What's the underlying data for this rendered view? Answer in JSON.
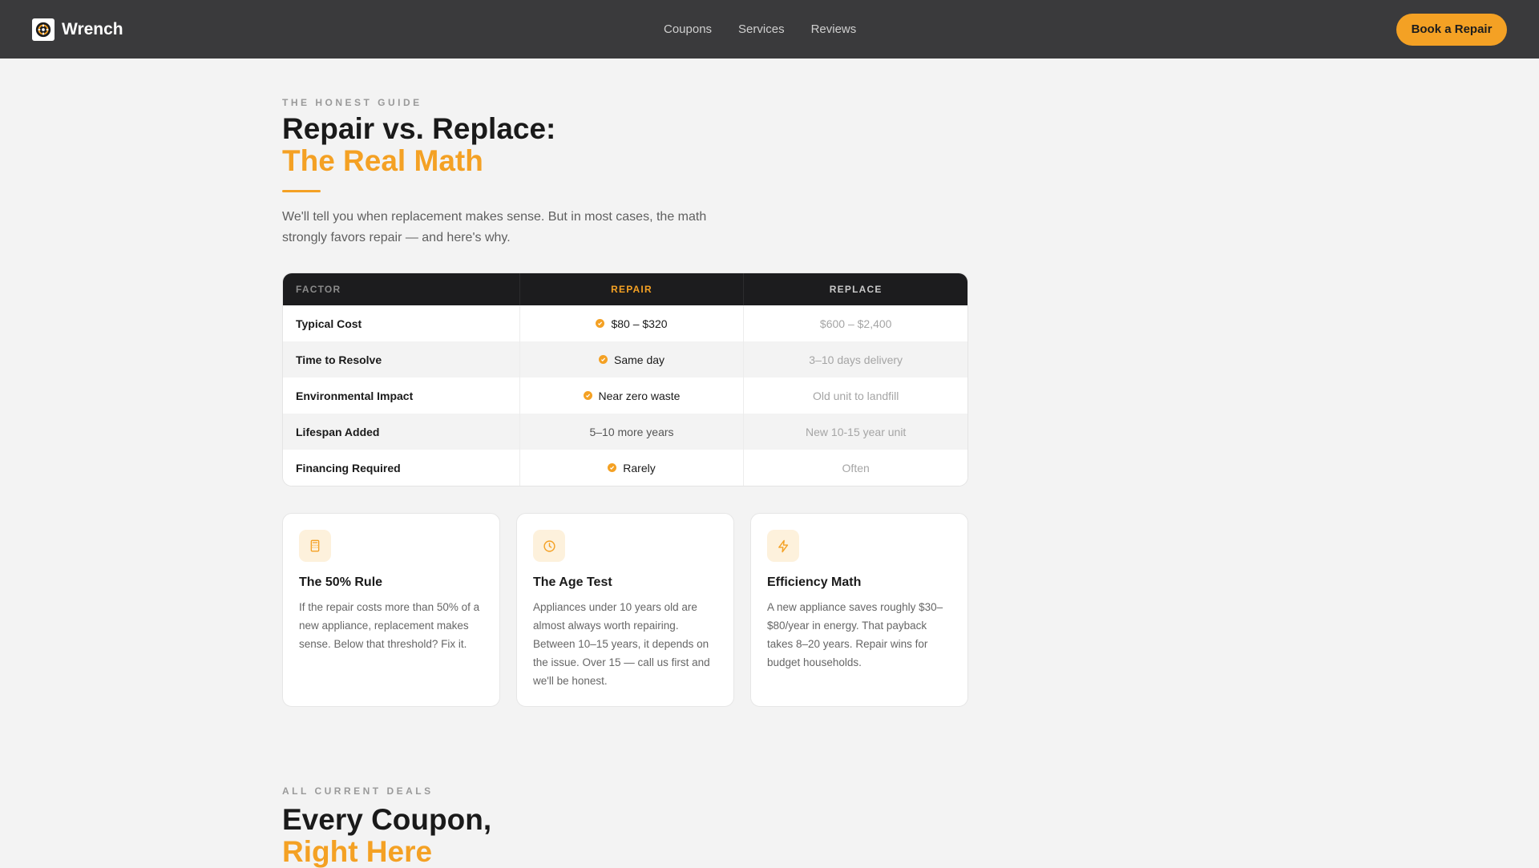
{
  "nav": {
    "brand": "Wrench",
    "links": [
      "Coupons",
      "Services",
      "Reviews"
    ],
    "cta": "Book a Repair"
  },
  "hero": {
    "eyebrow": "THE HONEST GUIDE",
    "title_line1": "Repair vs. Replace:",
    "title_line2": "The Real Math",
    "lede": "We'll tell you when replacement makes sense. But in most cases, the math strongly favors repair — and here's why."
  },
  "table": {
    "headers": [
      "FACTOR",
      "REPAIR",
      "REPLACE"
    ],
    "rows": [
      {
        "factor": "Typical Cost",
        "repair": "$80 – $320",
        "replace": "$600 – $2,400"
      },
      {
        "factor": "Time to Resolve",
        "repair": "Same day",
        "replace": "3–10 days delivery"
      },
      {
        "factor": "Environmental Impact",
        "repair": "Near zero waste",
        "replace": "Old unit to landfill"
      },
      {
        "factor": "Lifespan Added",
        "repair": "5–10 more years",
        "replace": "New 10-15 year unit"
      },
      {
        "factor": "Financing Required",
        "repair": "Rarely",
        "replace": "Often"
      }
    ]
  },
  "cards": [
    {
      "icon": "calculator-icon",
      "title": "The 50% Rule",
      "text": "If the repair costs more than 50% of a new appliance, replacement makes sense. Below that threshold? Fix it."
    },
    {
      "icon": "clock-icon",
      "title": "The Age Test",
      "text": "Appliances under 10 years old are almost always worth repairing. Between 10–15 years, it depends on the issue. Over 15 — call us first and we'll be honest."
    },
    {
      "icon": "lightning-icon",
      "title": "Efficiency Math",
      "text": "A new appliance saves roughly $30–$80/year in energy. That payback takes 8–20 years. Repair wins for budget households."
    }
  ],
  "deals": {
    "eyebrow": "ALL CURRENT DEALS",
    "title_line1": "Every Coupon,",
    "title_line2": "Right Here"
  },
  "colors": {
    "accent": "#f4a124",
    "nav_bg": "#3a3a3c",
    "table_header": "#1c1c1e",
    "page_bg": "#f3f3f3"
  }
}
